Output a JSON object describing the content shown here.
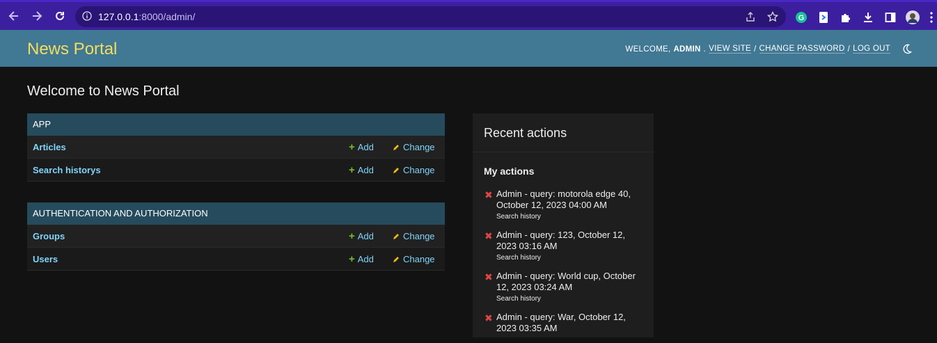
{
  "browser": {
    "url_host": "127.0.0.1",
    "url_rest": ":8000/admin/"
  },
  "header": {
    "brand": "News Portal",
    "welcome": "WELCOME,",
    "username": "ADMIN",
    "view_site": "VIEW SITE",
    "change_password": "CHANGE PASSWORD",
    "log_out": "LOG OUT",
    "separator": "/"
  },
  "main": {
    "title": "Welcome to News Portal",
    "modules": [
      {
        "caption": "APP",
        "rows": [
          {
            "model": "Articles",
            "add": "Add",
            "change": "Change"
          },
          {
            "model": "Search historys",
            "add": "Add",
            "change": "Change"
          }
        ]
      },
      {
        "caption": "AUTHENTICATION AND AUTHORIZATION",
        "rows": [
          {
            "model": "Groups",
            "add": "Add",
            "change": "Change"
          },
          {
            "model": "Users",
            "add": "Add",
            "change": "Change"
          }
        ]
      }
    ]
  },
  "recent": {
    "title": "Recent actions",
    "subtitle": "My actions",
    "items": [
      {
        "title": "Admin - query: motorola edge 40, October 12, 2023 04:00 AM",
        "type": "Search history"
      },
      {
        "title": "Admin - query: 123, October 12, 2023 03:16 AM",
        "type": "Search history"
      },
      {
        "title": "Admin - query: World cup, October 12, 2023 03:24 AM",
        "type": "Search history"
      },
      {
        "title": "Admin - query: War, October 12, 2023 03:35 AM",
        "type": ""
      }
    ]
  },
  "colors": {
    "chrome": "#3b1f9e",
    "header": "#417893",
    "brand": "#f5dd5d",
    "caption": "#264b5d",
    "link": "#81d4fa",
    "add_icon": "#70bf2b",
    "change_icon": "#efb80b",
    "delete_icon": "#dd4646"
  }
}
